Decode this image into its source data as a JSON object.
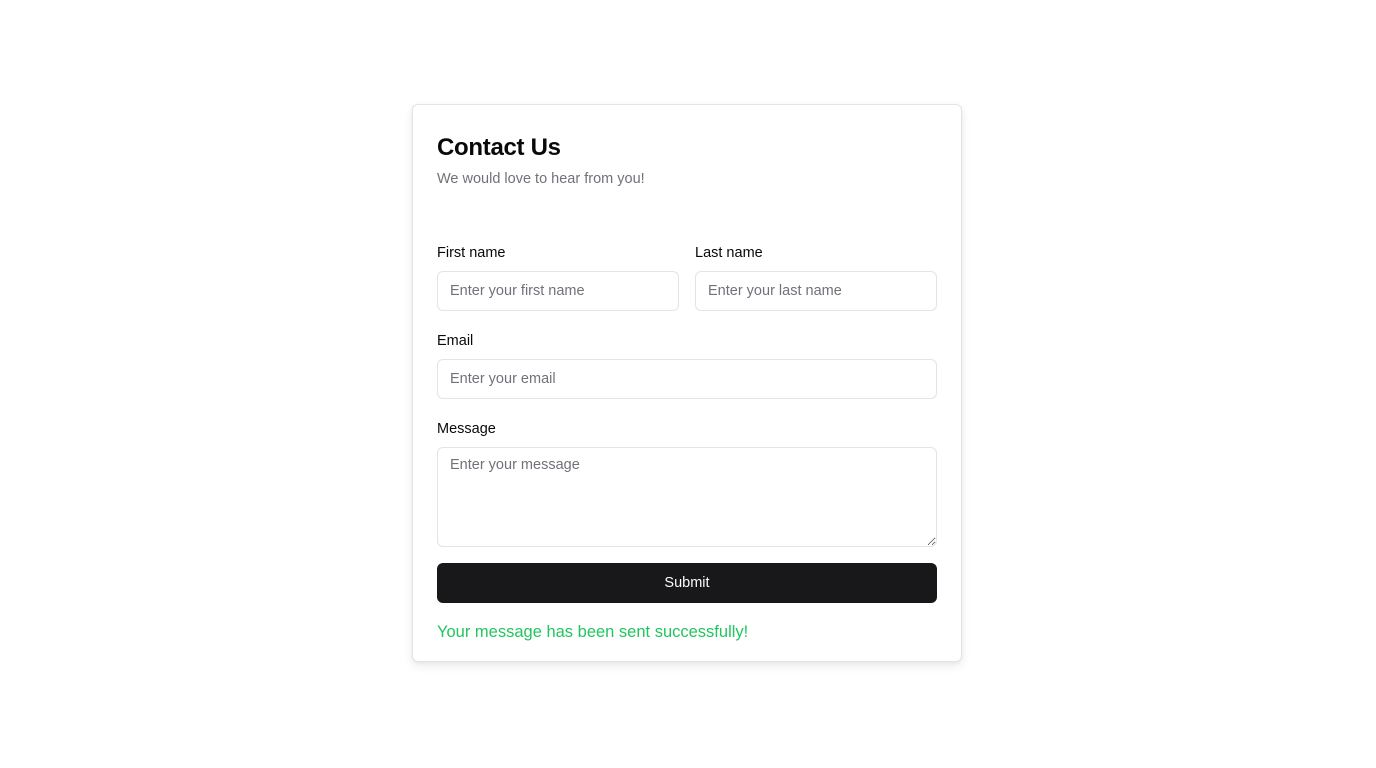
{
  "form": {
    "title": "Contact Us",
    "subtitle": "We would love to hear from you!",
    "first_name": {
      "label": "First name",
      "placeholder": "Enter your first name",
      "value": ""
    },
    "last_name": {
      "label": "Last name",
      "placeholder": "Enter your last name",
      "value": ""
    },
    "email": {
      "label": "Email",
      "placeholder": "Enter your email",
      "value": ""
    },
    "message": {
      "label": "Message",
      "placeholder": "Enter your message",
      "value": ""
    },
    "submit_label": "Submit",
    "success_message": "Your message has been sent successfully!"
  },
  "colors": {
    "primary_button": "#18181b",
    "success_text": "#22c55e",
    "muted_text": "#71717a",
    "border": "#e4e4e7"
  }
}
